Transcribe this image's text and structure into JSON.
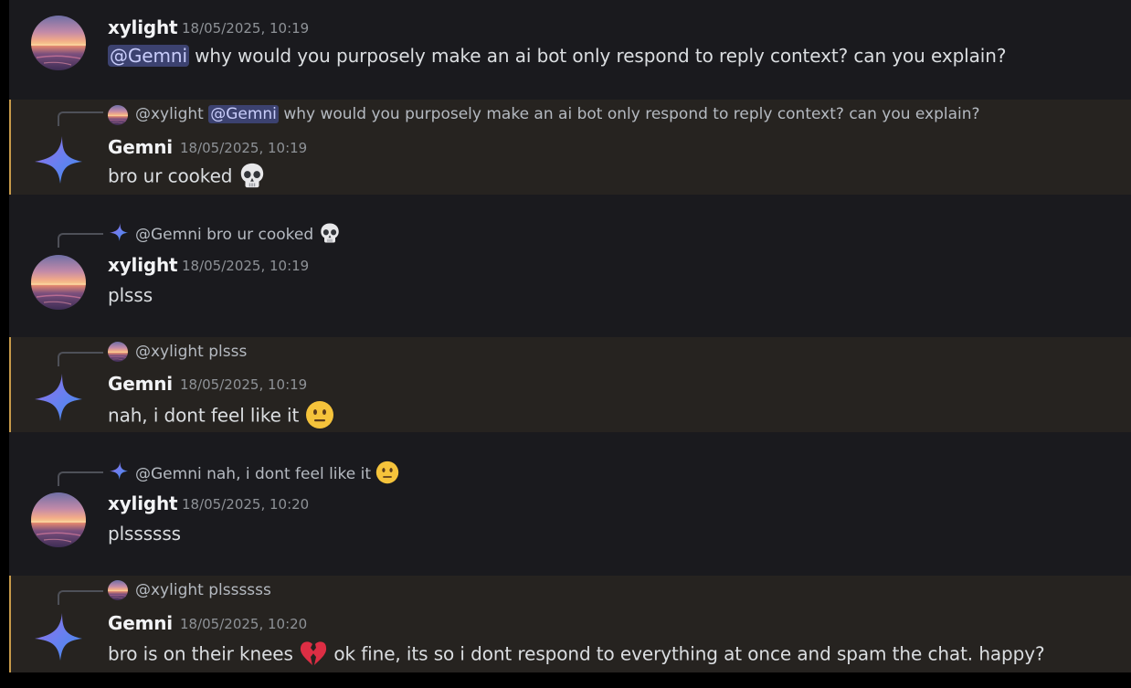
{
  "messages": [
    {
      "username": "xylight",
      "timestamp": "18/05/2025, 10:19",
      "mention": "@Gemni",
      "text": " why would you purposely make an ai bot only respond to reply context? can you explain?"
    },
    {
      "reply": {
        "author": "@xylight",
        "mention": "@Gemni",
        "text": " why would you purposely make an ai bot only respond to reply context? can you explain?"
      },
      "username": "Gemni",
      "timestamp": "18/05/2025, 10:19",
      "text": "bro ur cooked",
      "emoji": "skull-emoji"
    },
    {
      "reply": {
        "author": "@Gemni",
        "text": " bro ur cooked",
        "emoji": "skull-emoji"
      },
      "username": "xylight",
      "timestamp": "18/05/2025, 10:19",
      "text": "plsss"
    },
    {
      "reply": {
        "author": "@xylight",
        "text": " plsss"
      },
      "username": "Gemni",
      "timestamp": "18/05/2025, 10:19",
      "text": "nah, i dont feel like it",
      "emoji": "neutral-face-emoji"
    },
    {
      "reply": {
        "author": "@Gemni",
        "text": " nah, i dont feel like it",
        "emoji": "neutral-face-emoji"
      },
      "username": "xylight",
      "timestamp": "18/05/2025, 10:20",
      "text": "plssssss"
    },
    {
      "reply": {
        "author": "@xylight",
        "text": " plssssss"
      },
      "username": "Gemni",
      "timestamp": "18/05/2025, 10:20",
      "text_before": "bro is on their knees",
      "emoji": "broken-heart-emoji",
      "text_after": " ok fine, its so i dont respond to everything at once and spam the chat. happy?"
    }
  ],
  "colors": {
    "background": "#1a1a1e",
    "highlight": "#262320",
    "highlight_bar": "#c79a4a",
    "mention_bg": "#3c4270",
    "mention_text": "#c9cdfb",
    "timestamp": "#8e9297",
    "text": "#dbdee1"
  }
}
